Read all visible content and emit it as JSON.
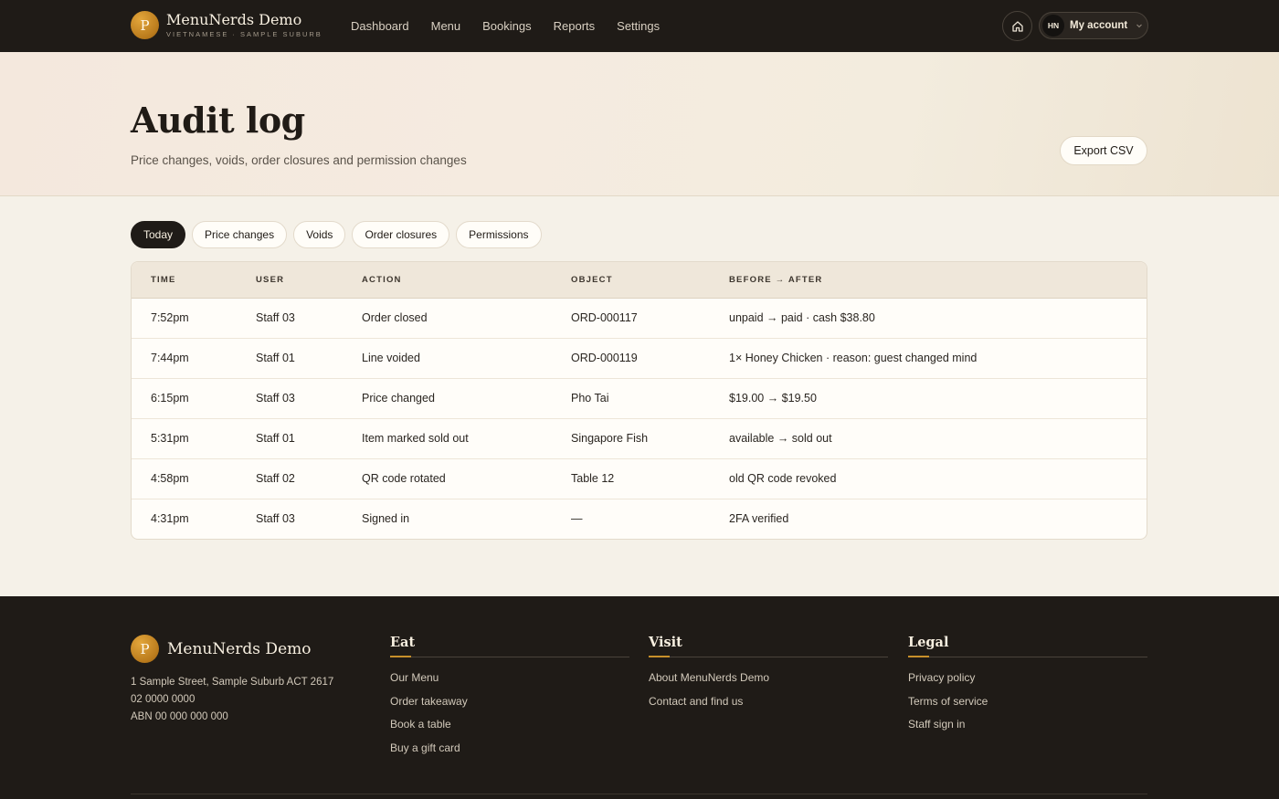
{
  "brand": {
    "initial": "P",
    "name": "MenuNerds Demo",
    "subtitle": "VIETNAMESE · SAMPLE SUBURB"
  },
  "nav": {
    "links": [
      "Dashboard",
      "Menu",
      "Bookings",
      "Reports",
      "Settings"
    ],
    "home_icon": "home-icon",
    "account": {
      "initials": "HN",
      "label": "My account",
      "chevron": "chevron-down-icon"
    }
  },
  "page": {
    "title": "Audit log",
    "subtitle": "Price changes, voids, order closures and permission changes",
    "export_label": "Export CSV"
  },
  "filters": [
    {
      "label": "Today",
      "active": true
    },
    {
      "label": "Price changes",
      "active": false
    },
    {
      "label": "Voids",
      "active": false
    },
    {
      "label": "Order closures",
      "active": false
    },
    {
      "label": "Permissions",
      "active": false
    }
  ],
  "table": {
    "columns": [
      "TIME",
      "USER",
      "ACTION",
      "OBJECT",
      "BEFORE → AFTER"
    ],
    "rows": [
      [
        "7:52pm",
        "Staff 03",
        "Order closed",
        "ORD-000117",
        "unpaid → paid · cash $38.80"
      ],
      [
        "7:44pm",
        "Staff 01",
        "Line voided",
        "ORD-000119",
        "1× Honey Chicken · reason: guest changed mind"
      ],
      [
        "6:15pm",
        "Staff 03",
        "Price changed",
        "Pho Tai",
        "$19.00 → $19.50"
      ],
      [
        "5:31pm",
        "Staff 01",
        "Item marked sold out",
        "Singapore Fish",
        "available → sold out"
      ],
      [
        "4:58pm",
        "Staff 02",
        "QR code rotated",
        "Table 12",
        "old QR code revoked"
      ],
      [
        "4:31pm",
        "Staff 03",
        "Signed in",
        "—",
        "2FA verified"
      ]
    ]
  },
  "footer": {
    "brand_initial": "P",
    "brand_name": "MenuNerds Demo",
    "address": "1 Sample Street, Sample Suburb ACT 2617",
    "phone": "02 0000 0000",
    "abn": "ABN 00 000 000 000",
    "columns": [
      {
        "heading": "Eat",
        "links": [
          "Our Menu",
          "Order takeaway",
          "Book a table",
          "Buy a gift card"
        ]
      },
      {
        "heading": "Visit",
        "links": [
          "About MenuNerds Demo",
          "Contact and find us"
        ]
      },
      {
        "heading": "Legal",
        "links": [
          "Privacy policy",
          "Terms of service",
          "Staff sign in"
        ]
      }
    ]
  },
  "colors": {
    "nav_bg": "#1f1b17",
    "page_bg": "#f5f1e8",
    "accent_gold": "#c8902a"
  }
}
